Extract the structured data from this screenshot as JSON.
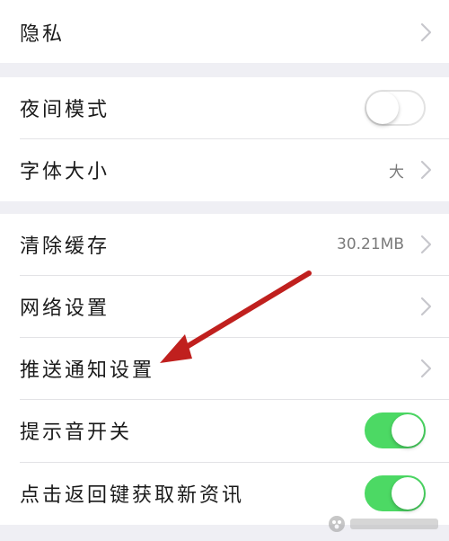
{
  "settings": {
    "privacy": {
      "label": "隐私"
    },
    "night_mode": {
      "label": "夜间模式",
      "enabled": false
    },
    "font_size": {
      "label": "字体大小",
      "value": "大"
    },
    "clear_cache": {
      "label": "清除缓存",
      "value": "30.21MB"
    },
    "network": {
      "label": "网络设置"
    },
    "push": {
      "label": "推送通知设置"
    },
    "sound": {
      "label": "提示音开关",
      "enabled": true
    },
    "back_key": {
      "label": "点击返回键获取新资讯",
      "enabled": true
    }
  },
  "colors": {
    "background": "#efeff4",
    "toggle_on": "#4cd964",
    "annotation_arrow": "#c0201e"
  },
  "icons": {
    "chevron": "chevron-right-icon",
    "arrow": "annotation-arrow-icon",
    "watermark": "watermark-logo"
  }
}
